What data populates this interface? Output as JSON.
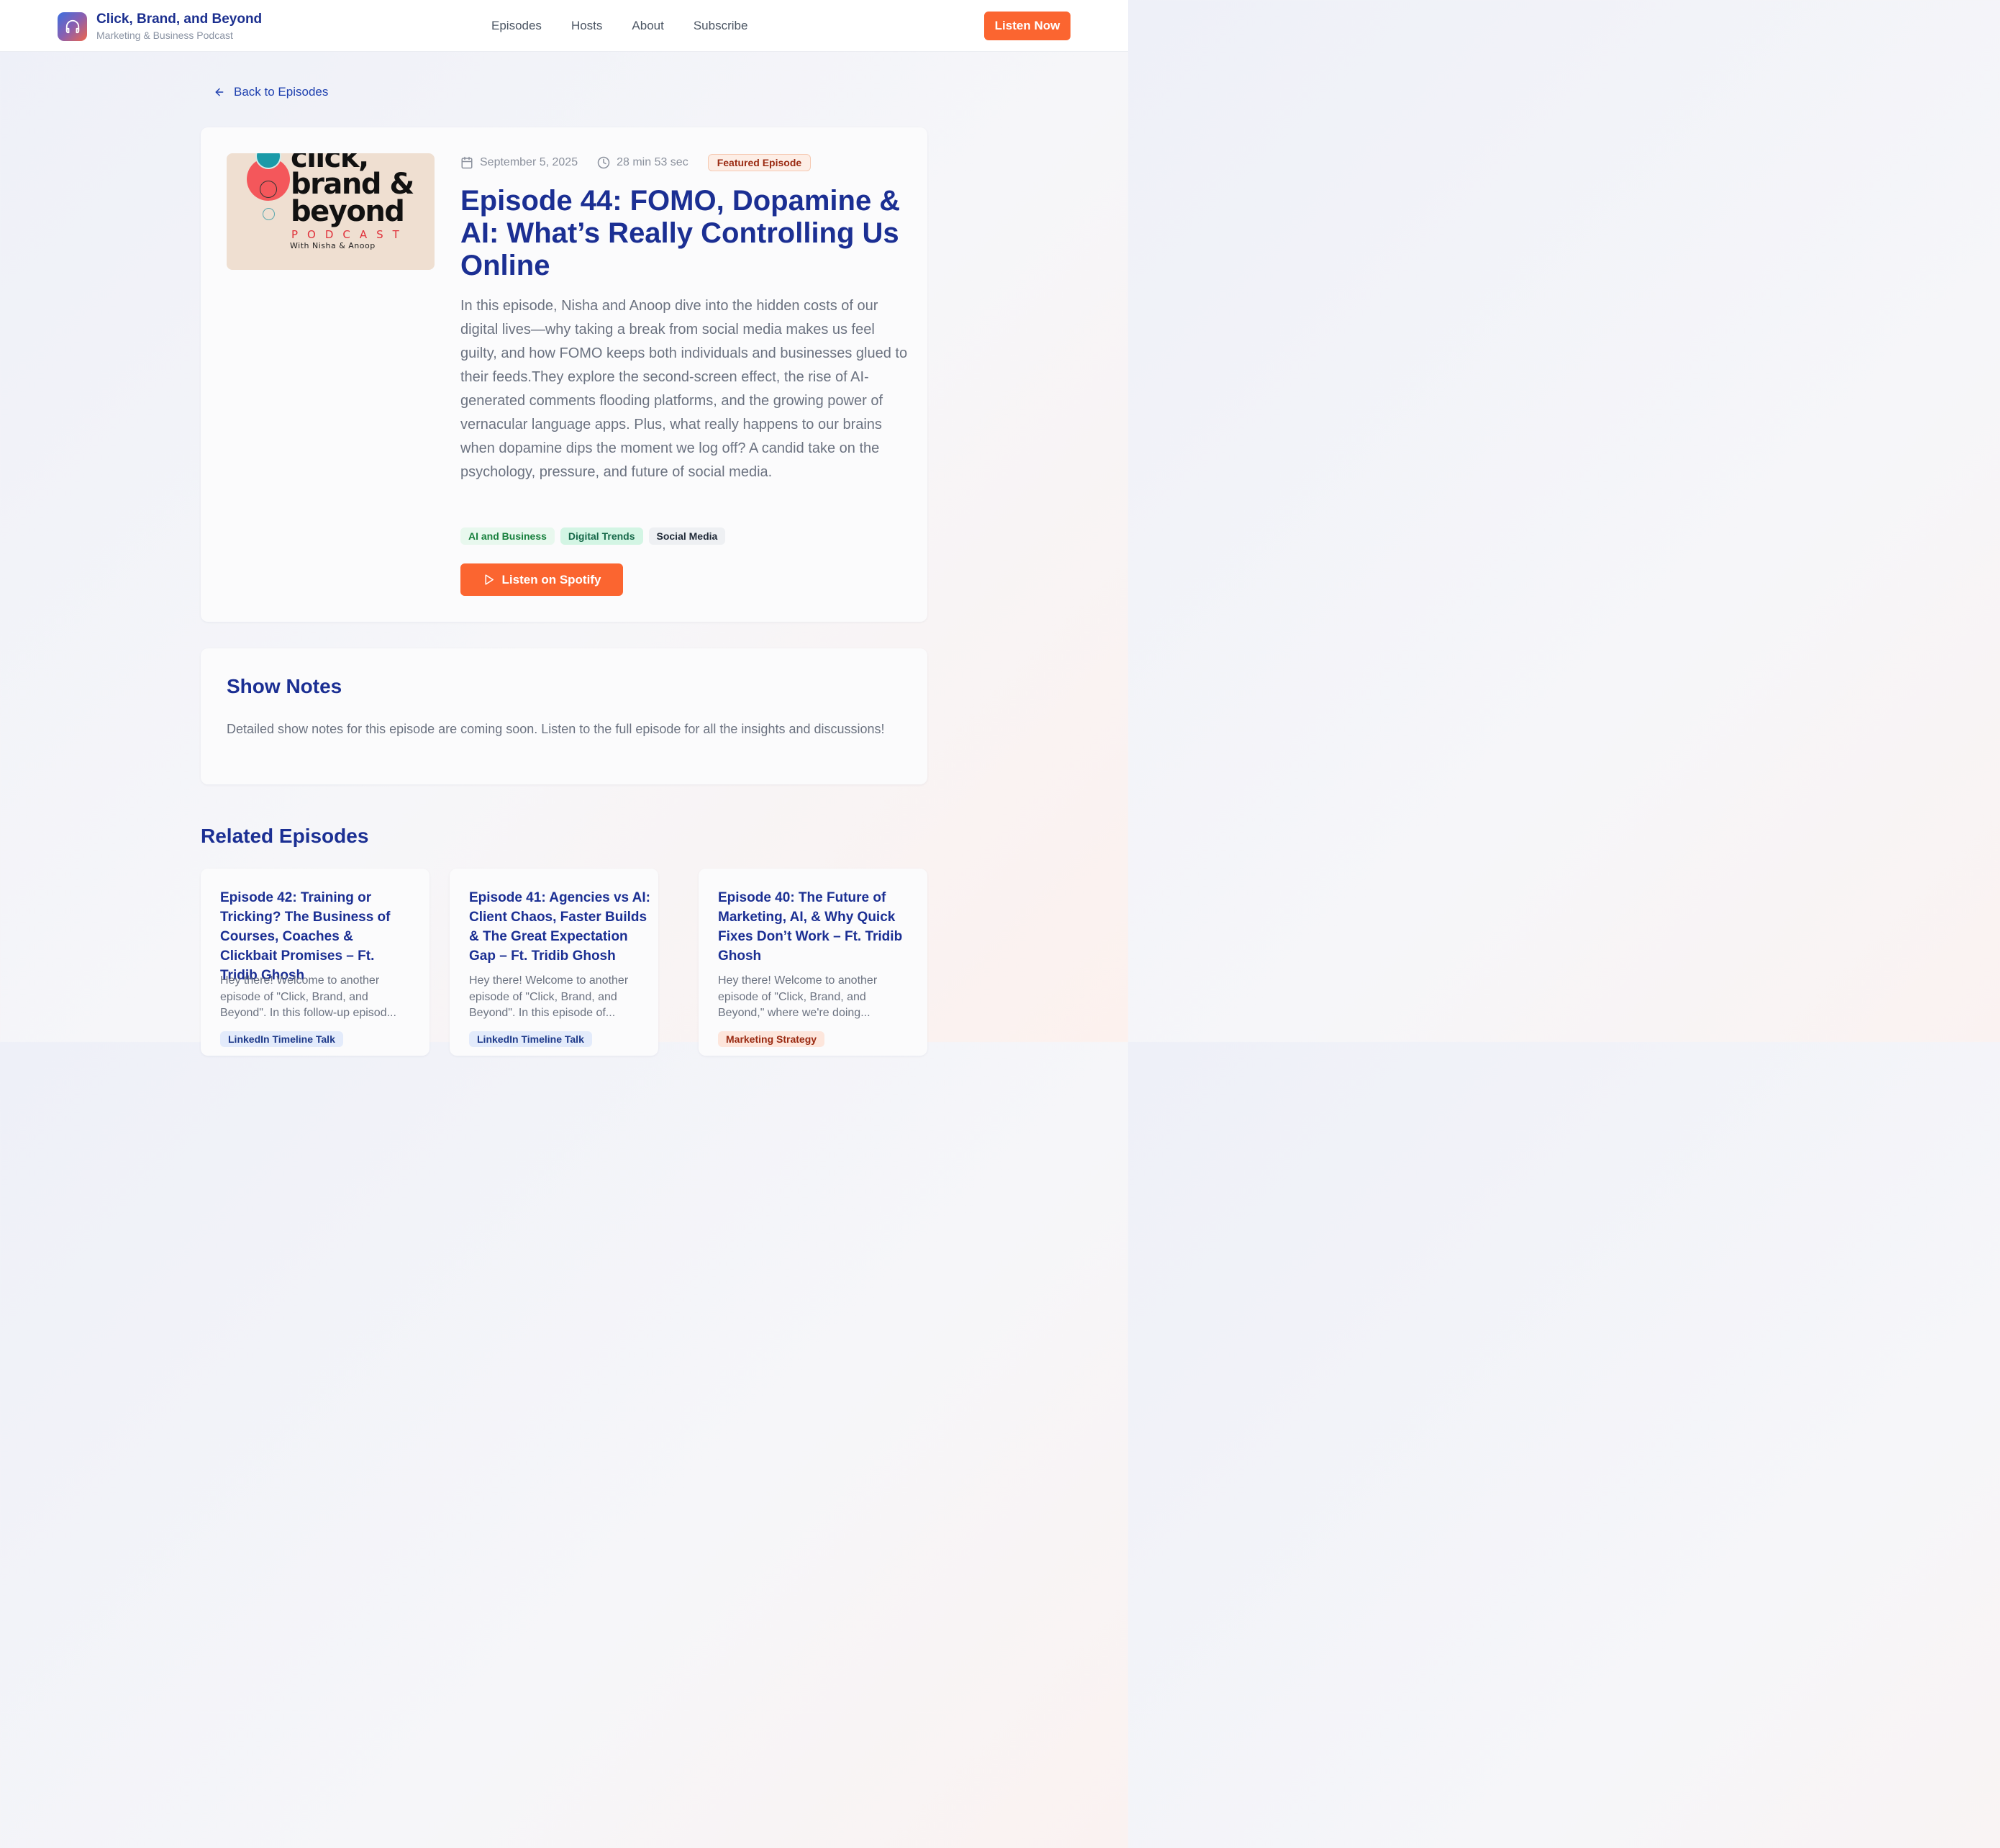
{
  "header": {
    "title": "Click, Brand, and Beyond",
    "subtitle": "Marketing & Business Podcast",
    "logo_icon": "headphones-icon",
    "nav": [
      "Episodes",
      "Hosts",
      "About",
      "Subscribe"
    ],
    "cta": "Listen Now"
  },
  "back_link": "Back to Episodes",
  "episode": {
    "cover": {
      "line1": "click,",
      "line2": "brand &",
      "line3": "beyond",
      "podcast": "PODCAST",
      "with": "With Nisha & Anoop"
    },
    "date": "September 5, 2025",
    "duration": "28 min 53 sec",
    "badge": "Featured Episode",
    "title": "Episode 44: FOMO, Dopamine & AI: What’s Really Controlling Us Online",
    "description": "In this episode, Nisha and Anoop dive into the hidden costs of our digital lives—why taking a break from social media makes us feel guilty, and how FOMO keeps both individuals and businesses glued to their feeds.They explore the second-screen effect, the rise of AI-generated comments flooding platforms, and the growing power of vernacular language apps. Plus, what really happens to our brains when dopamine dips the moment we log off? A candid take on the psychology, pressure, and future of social media.",
    "tags": [
      "AI and Business",
      "Digital Trends",
      "Social Media"
    ],
    "listen_button": "Listen on Spotify"
  },
  "show_notes": {
    "title": "Show Notes",
    "text": "Detailed show notes for this episode are coming soon. Listen to the full episode for all the insights and discussions!"
  },
  "related": {
    "title": "Related Episodes",
    "items": [
      {
        "title": "Episode 42: Training or Tricking? The Business of Courses, Coaches & Clickbait Promises – Ft. Tridib Ghosh",
        "excerpt": "Hey there! Welcome to another episode of \"Click, Brand, and Beyond\". In this follow-up episod...",
        "tag": "LinkedIn Timeline Talk"
      },
      {
        "title": "Episode 41: Agencies vs AI: Client Chaos, Faster Builds & The Great Expectation Gap – Ft. Tridib Ghosh",
        "excerpt": "Hey there! Welcome to another episode of \"Click, Brand, and Beyond\". In this episode of...",
        "tag": "LinkedIn Timeline Talk"
      },
      {
        "title": "Episode 40: The Future of Marketing, AI, & Why Quick Fixes Don’t Work – Ft. Tridib Ghosh",
        "excerpt": "Hey there! Welcome to another episode of \"Click, Brand, and Beyond,\" where we're doing...",
        "tag": "Marketing Strategy"
      }
    ]
  },
  "colors": {
    "primary": "#1b2f93",
    "accent": "#fb6530"
  }
}
